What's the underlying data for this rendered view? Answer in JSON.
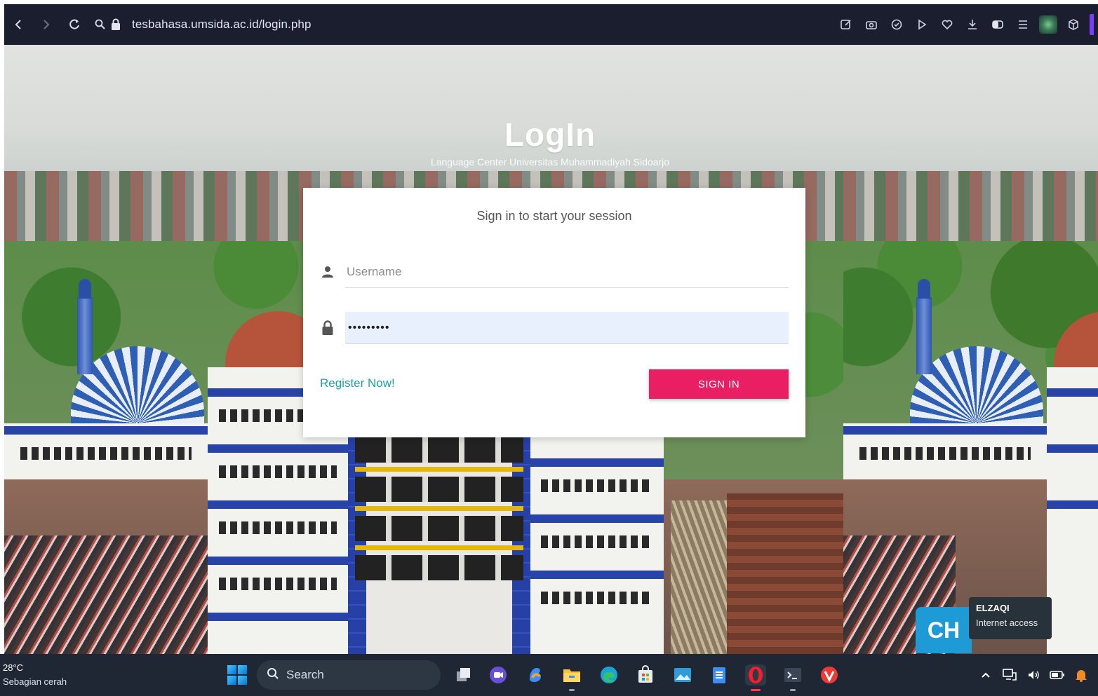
{
  "browser": {
    "url": "tesbahasa.umsida.ac.id/login.php",
    "icons": [
      "back-icon",
      "forward-icon",
      "reload-icon",
      "site-info-icon",
      "lock-icon"
    ],
    "toolbar_icons": [
      "edit-icon",
      "camera-icon",
      "shield-check-icon",
      "play-icon",
      "heart-icon",
      "download-icon",
      "toggle-icon",
      "menu-icon",
      "extension-avatar-icon",
      "cube-icon"
    ]
  },
  "login": {
    "title": "LogIn",
    "subtitle": "Language Center Universitas Muhammadiyah Sidoarjo",
    "message": "Sign in to start your session",
    "username_placeholder": "Username",
    "username_value": "",
    "password_value": "•••••••••",
    "register_label": "Register Now!",
    "signin_label": "SIGN IN",
    "accent_color": "#e91e63",
    "link_color": "#1aa3a3"
  },
  "overlay": {
    "logo_text": "CH",
    "network_name": "ELZAQI",
    "network_status": "Internet access"
  },
  "taskbar": {
    "temperature": "28°C",
    "weather": "Sebagian cerah",
    "search_label": "Search",
    "apps": [
      "task-view-icon",
      "chat-icon",
      "copilot-icon",
      "file-explorer-icon",
      "edge-icon",
      "store-icon",
      "photos-icon",
      "notepad-icon",
      "opera-icon",
      "terminal-icon",
      "vivaldi-icon"
    ]
  }
}
